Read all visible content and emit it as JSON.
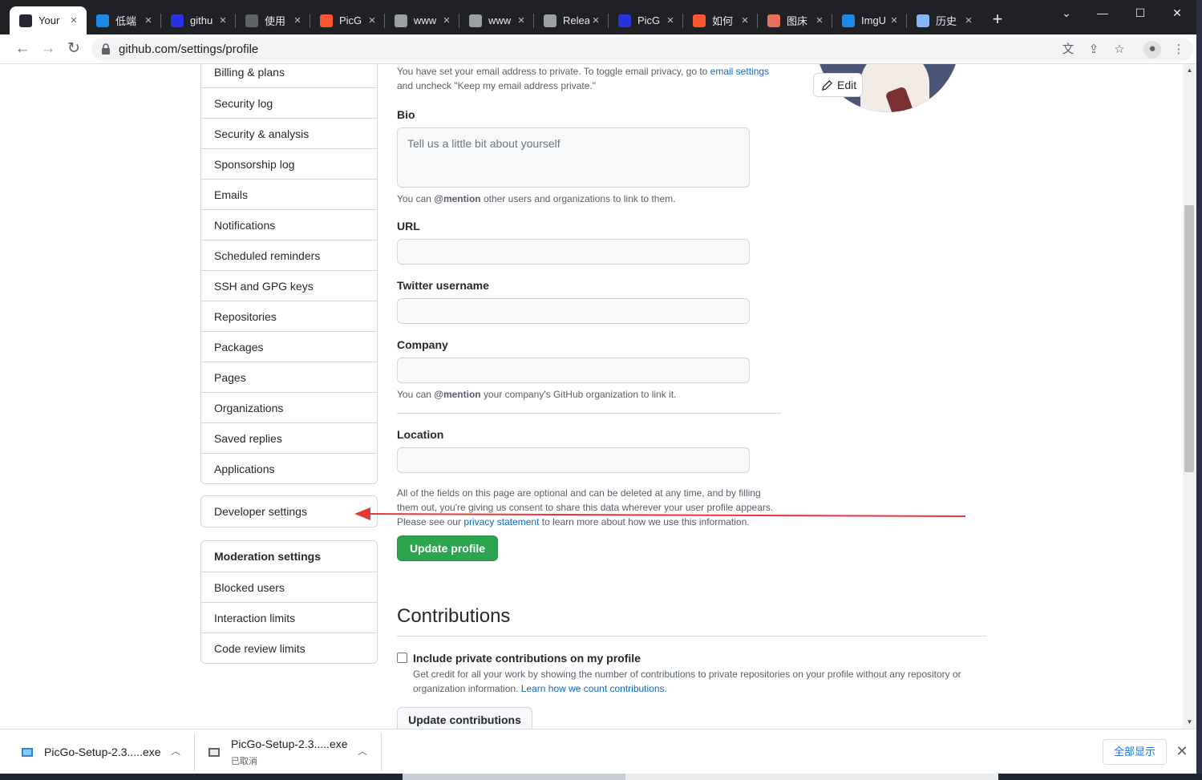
{
  "browser": {
    "tabs": [
      {
        "title": "Your",
        "favicon": "github-icon",
        "color": "#24292f"
      },
      {
        "title": "低端",
        "favicon": "dd-icon",
        "color": "#1e88e5"
      },
      {
        "title": "githu",
        "favicon": "baidu-paw-icon",
        "color": "#2932e1"
      },
      {
        "title": "使用",
        "favicon": "loading-icon",
        "color": "#5f6368"
      },
      {
        "title": "PicG",
        "favicon": "csdn-icon",
        "color": "#fc5531"
      },
      {
        "title": "www",
        "favicon": "globe-icon",
        "color": "#9aa0a6"
      },
      {
        "title": "www",
        "favicon": "globe-icon",
        "color": "#9aa0a6"
      },
      {
        "title": "Relea",
        "favicon": "github-icon",
        "color": "#9aa0a6"
      },
      {
        "title": "PicG",
        "favicon": "baidu-paw-icon",
        "color": "#2932e1"
      },
      {
        "title": "如何",
        "favicon": "csdn-icon",
        "color": "#fc5531"
      },
      {
        "title": "图床",
        "favicon": "jianshu-icon",
        "color": "#ea6f5a"
      },
      {
        "title": "ImgU",
        "favicon": "image-icon",
        "color": "#1e88e5"
      },
      {
        "title": "历史",
        "favicon": "history-icon",
        "color": "#8ab4f8"
      }
    ],
    "url": "github.com/settings/profile"
  },
  "sidebar": {
    "menu_top": [
      "Billing & plans",
      "Security log",
      "Security & analysis",
      "Sponsorship log",
      "Emails",
      "Notifications",
      "Scheduled reminders",
      "SSH and GPG keys",
      "Repositories",
      "Packages",
      "Pages",
      "Organizations",
      "Saved replies",
      "Applications"
    ],
    "developer": "Developer settings",
    "moderation_header": "Moderation settings",
    "moderation_items": [
      "Blocked users",
      "Interaction limits",
      "Code review limits"
    ]
  },
  "profile": {
    "email_note_pre": "You have set your email address to private. To toggle email privacy, go to ",
    "email_note_link": "email settings",
    "email_note_post": "and uncheck \"Keep my email address private.\"",
    "bio_label": "Bio",
    "bio_placeholder": "Tell us a little bit about yourself",
    "bio_hint_pre": "You can ",
    "bio_hint_bold": "@mention",
    "bio_hint_post": " other users and organizations to link to them.",
    "url_label": "URL",
    "twitter_label": "Twitter username",
    "company_label": "Company",
    "company_hint_pre": "You can ",
    "company_hint_bold": "@mention",
    "company_hint_post": " your company's GitHub organization to link it.",
    "location_label": "Location",
    "fields_note_1": "All of the fields on this page are optional and can be deleted at any time, and by filling",
    "fields_note_2": "them out, you're giving us consent to share this data wherever your user profile appears.",
    "fields_note_3_pre": "Please see our ",
    "fields_note_3_link": "privacy statement",
    "fields_note_3_post": " to learn more about how we use this information.",
    "update_button": "Update profile",
    "edit_button": "Edit"
  },
  "contributions": {
    "heading": "Contributions",
    "checkbox_label": "Include private contributions on my profile",
    "desc_1": "Get credit for all your work by showing the number of contributions to private repositories on your profile without any repository or",
    "desc_2_pre": "organization information. ",
    "desc_2_link": "Learn how we count contributions.",
    "button": "Update contributions"
  },
  "downloads": {
    "items": [
      {
        "name": "PicGo-Setup-2.3.....exe",
        "status": ""
      },
      {
        "name": "PicGo-Setup-2.3.....exe",
        "status": "已取消"
      }
    ],
    "show_all": "全部显示"
  },
  "colors": {
    "primary_button": "#2da44e",
    "link": "#0969da",
    "annotation_arrow": "#e53935"
  }
}
